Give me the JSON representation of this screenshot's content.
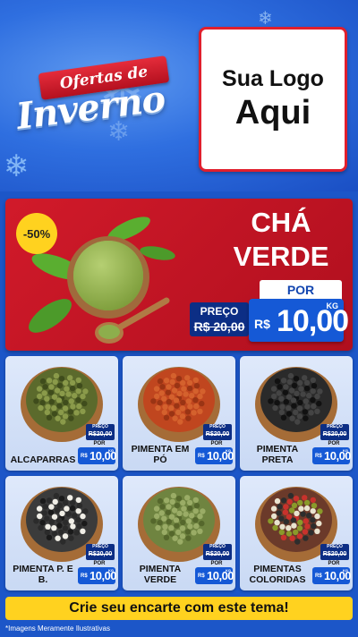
{
  "header": {
    "banner_text": "Ofertas de",
    "title_text": "Inverno",
    "logo_line1": "Sua Logo",
    "logo_line2": "Aqui"
  },
  "feature": {
    "discount": "-50%",
    "title_line1": "CHÁ",
    "title_line2": "VERDE",
    "por_label": "POR",
    "preco_label": "PREÇO",
    "old_price": "R$ 20,00",
    "currency": "R$",
    "price": "10,00",
    "unit": "KG"
  },
  "products": [
    {
      "name": "ALCAPARRAS",
      "preco_label": "PREÇO",
      "old_price": "R$20,00",
      "por_label": "POR",
      "currency": "R$",
      "price": "10,00",
      "unit": "KG"
    },
    {
      "name": "PIMENTA EM PÓ",
      "preco_label": "PREÇO",
      "old_price": "R$20,00",
      "por_label": "POR",
      "currency": "R$",
      "price": "10,00",
      "unit": "KG"
    },
    {
      "name": "PIMENTA PRETA",
      "preco_label": "PREÇO",
      "old_price": "R$20,00",
      "por_label": "POR",
      "currency": "R$",
      "price": "10,00",
      "unit": "KG"
    },
    {
      "name": "PIMENTA P. E B.",
      "preco_label": "PREÇO",
      "old_price": "R$20,00",
      "por_label": "POR",
      "currency": "R$",
      "price": "10,00",
      "unit": "KG"
    },
    {
      "name": "PIMENTA VERDE",
      "preco_label": "PREÇO",
      "old_price": "R$20,00",
      "por_label": "POR",
      "currency": "R$",
      "price": "10,00",
      "unit": "KG"
    },
    {
      "name": "PIMENTAS COLORIDAS",
      "preco_label": "PREÇO",
      "old_price": "R$20,00",
      "por_label": "POR",
      "currency": "R$",
      "price": "10,00",
      "unit": "KG"
    }
  ],
  "footer": {
    "cta": "Crie seu encarte com este tema!",
    "disclaimer": "*Imagens Meramente Ilustrativas"
  },
  "colors": {
    "background_blue": "#1c56c8",
    "accent_red": "#d11a2a",
    "price_blue": "#1559d6",
    "label_navy": "#0c2e85",
    "badge_yellow": "#ffd21f"
  }
}
